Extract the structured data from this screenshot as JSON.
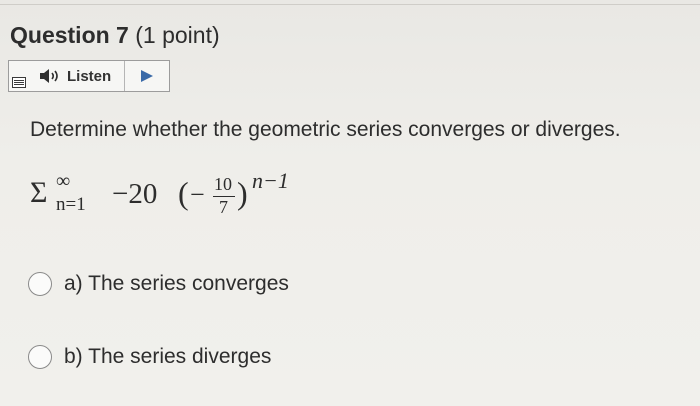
{
  "question": {
    "name": "Question 7",
    "points": "(1 point)"
  },
  "listen": {
    "label": "Listen",
    "menu_icon": "menu-icon",
    "speaker_icon": "speaker-icon",
    "play_icon": "play-icon"
  },
  "instruction": "Determine whether the geometric series converges or diverges.",
  "formula": {
    "sigma": "Σ",
    "upper": "∞",
    "lower": "n=1",
    "coefficient": "−20",
    "lparen": "(",
    "sign": "−",
    "numerator": "10",
    "denominator": "7",
    "rparen": ")",
    "exponent": "n−1"
  },
  "options": [
    {
      "letter": "a)",
      "text": "a) The series converges",
      "selected": false
    },
    {
      "letter": "b)",
      "text": "b) The series diverges",
      "selected": false
    }
  ],
  "colors": {
    "text": "#2d2d2d",
    "background": "#efeeea",
    "radio_border": "#8a8a8a",
    "play_blue": "#3a6aa8"
  }
}
